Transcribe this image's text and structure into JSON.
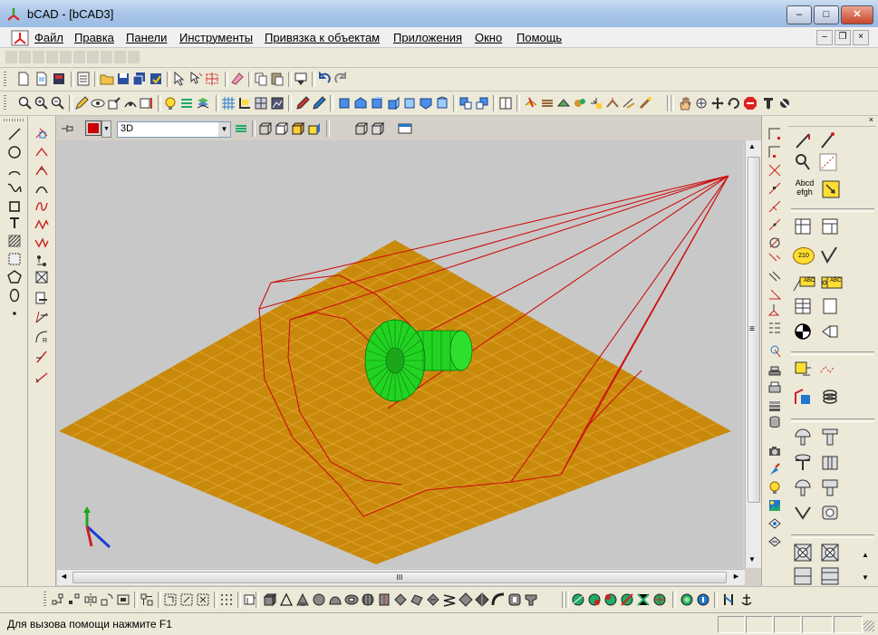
{
  "window": {
    "title": "bCAD - [bCAD3]",
    "minimize_glyph": "–",
    "maximize_glyph": "□",
    "close_glyph": "✕"
  },
  "menu": {
    "items": [
      "Файл",
      "Правка",
      "Панели",
      "Инструменты",
      "Привязка к объектам",
      "Приложения",
      "Окно",
      "Помощь"
    ],
    "mdi_minimize": "–",
    "mdi_restore": "❐",
    "mdi_close": "×"
  },
  "view_toolbar": {
    "color_swatch": "#cc0000",
    "view_mode": "3D"
  },
  "scrollbar": {
    "hthumb_grip": "III",
    "vthumb_grip": "≡"
  },
  "right_palette": {
    "text_sample_line1": "Abcd",
    "text_sample_line2": "efgh",
    "dimension_label": "210",
    "abc_label": "ABC"
  },
  "status": {
    "text": "Для вызова помощи нажмите F1"
  },
  "colors": {
    "floor": "#c98a0c",
    "floor_grid": "#e2a633",
    "wire": "#cc1111",
    "model": "#22d422",
    "viewport_bg": "#c8c8c8"
  },
  "icons": [
    "app-logo-icon",
    "new-file-icon",
    "open-folder-icon",
    "save-icon",
    "zoom-icon",
    "undo-icon",
    "redo-icon",
    "line-icon",
    "circle-icon",
    "arc-icon",
    "rectangle-icon",
    "text-icon",
    "hatch-icon",
    "polygon-icon",
    "ellipse-icon",
    "point-icon",
    "hand-pan-icon",
    "axis-icon"
  ]
}
